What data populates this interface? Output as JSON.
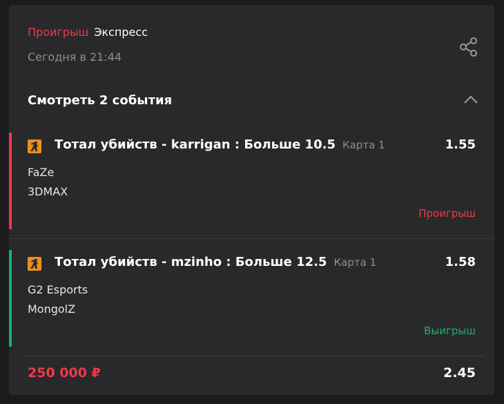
{
  "bet": {
    "status": "Проигрыш",
    "type": "Экспресс",
    "date": "Сегодня в 21:44",
    "events_toggle": "Смотреть 2 события",
    "stake": "250 000 ₽",
    "total_odds": "2.45"
  },
  "events": [
    {
      "market": "Тотал убийств - karrigan : Больше 10.5",
      "map": "Карта 1",
      "odds": "1.55",
      "team1": "FaZe",
      "team2": "3DMAX",
      "result": "Проигрыш",
      "result_color": "#f0384b"
    },
    {
      "market": "Тотал убийств - mzinho : Больше 12.5",
      "map": "Карта 1",
      "odds": "1.58",
      "team1": "G2 Esports",
      "team2": "MongolZ",
      "result": "Выигрыш",
      "result_color": "#1bb36a"
    }
  ],
  "icons": {
    "share": "share-icon",
    "chevron": "chevron-up-icon",
    "sport": "cs-sport-icon"
  },
  "colors": {
    "lost": "#f0384b",
    "won": "#1bb36a",
    "sport_icon": "#e8901e"
  }
}
